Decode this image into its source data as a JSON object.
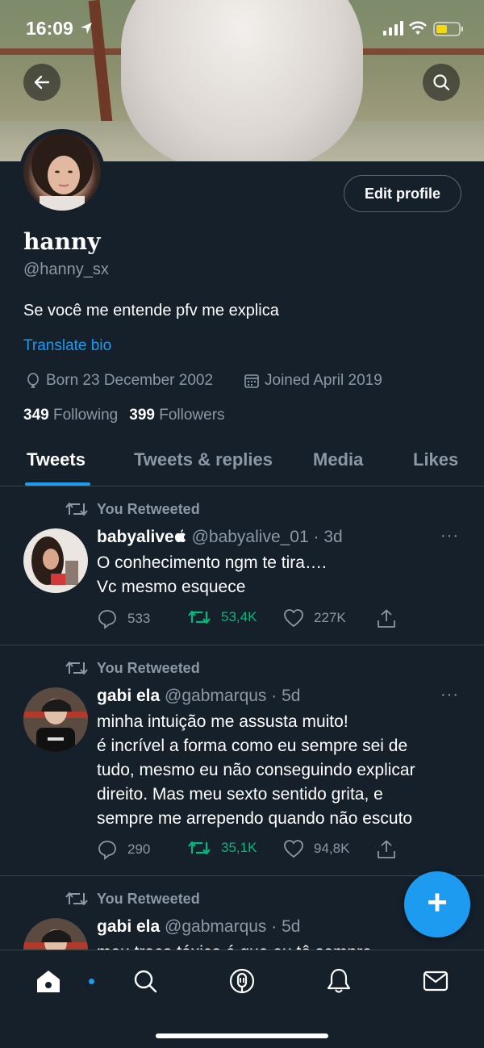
{
  "status_bar": {
    "time": "16:09"
  },
  "header": {
    "back_icon": "arrow-left-icon",
    "search_icon": "search-icon"
  },
  "profile": {
    "edit_label": "Edit profile",
    "name": "hanny",
    "handle": "@hanny_sx",
    "bio": "Se você me entende pfv me explica",
    "translate_label": "Translate bio",
    "born": "Born 23 December 2002",
    "joined": "Joined April 2019",
    "following_count": "349",
    "following_label": "Following",
    "followers_count": "399",
    "followers_label": "Followers"
  },
  "tabs": [
    {
      "label": "Tweets",
      "active": true
    },
    {
      "label": "Tweets & replies",
      "active": false
    },
    {
      "label": "Media",
      "active": false
    },
    {
      "label": "Likes",
      "active": false
    }
  ],
  "tweets": [
    {
      "retweet_label": "You Retweeted",
      "name": "babyalive",
      "handle_time": "@babyalive_01 · 3d",
      "more": "···",
      "lines": [
        "O conhecimento ngm te tira….",
        "Vc mesmo esquece"
      ],
      "replies": "533",
      "retweets": "53,4K",
      "likes": "227K"
    },
    {
      "retweet_label": "You Retweeted",
      "name": "gabi ela",
      "handle_time": "@gabmarqus · 5d",
      "more": "···",
      "lines": [
        "minha intuição me assusta muito!",
        "é incrível a forma como eu sempre sei de",
        "tudo, mesmo eu não conseguindo explicar",
        "direito. Mas meu sexto sentido grita, e",
        "sempre me arrependo quando não escuto"
      ],
      "replies": "290",
      "retweets": "35,1K",
      "likes": "94,8K"
    },
    {
      "retweet_label": "You Retweeted",
      "name": "gabi ela",
      "handle_time": "@gabmarqus · 5d",
      "lines": [
        "meu traço tóxico é que eu tô sempre"
      ]
    }
  ],
  "fab_label": "+",
  "nav": [
    "home-icon",
    "search-icon",
    "spaces-icon",
    "notifications-icon",
    "messages-icon"
  ],
  "colors": {
    "accent": "#1d9bf0",
    "retweet_green": "#00ba7c",
    "background": "#15202b",
    "muted": "#8b98a5"
  }
}
